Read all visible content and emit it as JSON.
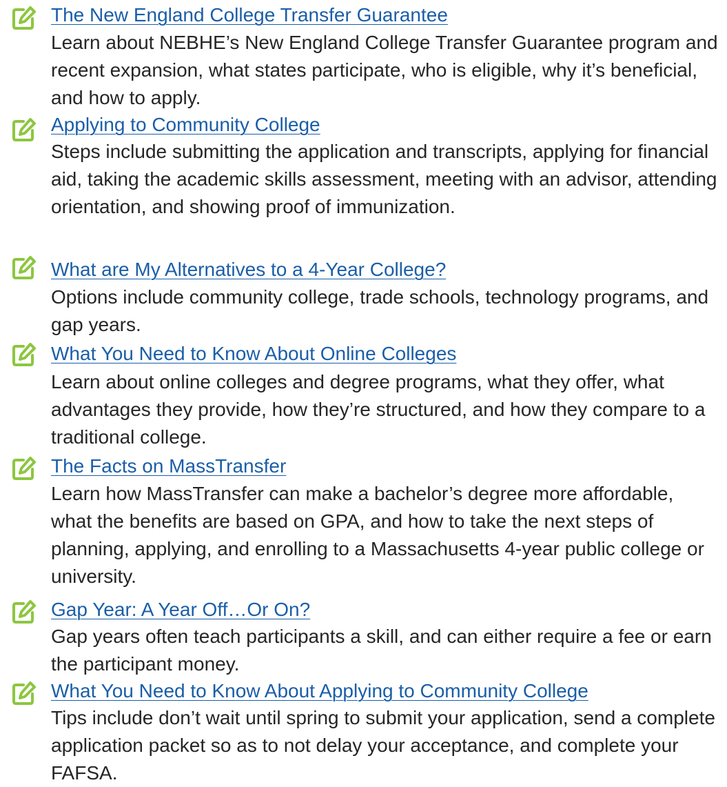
{
  "colors": {
    "link": "#1a5ea8",
    "text": "#262626",
    "icon": "#8cc63f"
  },
  "icon_name": "edit-icon",
  "items": [
    {
      "title": "The New England College Transfer Guarantee",
      "description": "Learn about NEBHE’s New England College Transfer Guarantee program and recent expansion, what states participate, who is eligible, why it’s beneficial, and how to apply."
    },
    {
      "title": "Applying to Community College",
      "description": "Steps include submitting the application and transcripts, applying for financial aid, taking the academic skills assessment, meeting with an advisor, attending orientation, and showing proof of immunization."
    },
    {
      "title": "What are My Alternatives to a 4-Year College?",
      "description": "Options include community college, trade schools, technology programs, and gap years."
    },
    {
      "title": "What You Need to Know About Online Colleges",
      "description": "Learn about online colleges and degree programs, what they offer, what advantages they provide, how they’re structured, and how they compare to a traditional college."
    },
    {
      "title": "The Facts on MassTransfer",
      "description": "Learn how MassTransfer can make a bachelor’s degree more affordable, what the benefits are based on GPA, and how to take the next steps of planning, applying, and enrolling to a Massachusetts 4-year public college or university."
    },
    {
      "title": "Gap Year: A Year Off…Or On?",
      "description": "Gap years often teach participants a skill, and can either require a fee or earn the participant money."
    },
    {
      "title": "What You Need to Know About Applying to Community College",
      "description": "Tips include don’t wait until spring to submit your application, send a complete application packet so as to not delay your acceptance, and complete your FAFSA."
    }
  ]
}
